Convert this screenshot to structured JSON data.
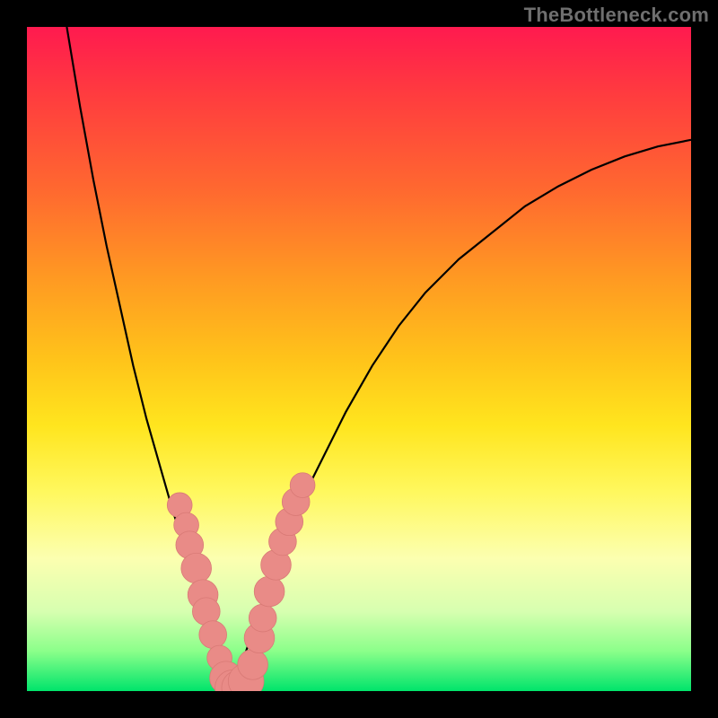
{
  "watermark": "TheBottleneck.com",
  "colors": {
    "dot": "#e98b87",
    "curve": "#000000"
  },
  "chart_data": {
    "type": "line",
    "title": "",
    "xlabel": "",
    "ylabel": "",
    "xlim": [
      0,
      100
    ],
    "ylim": [
      0,
      100
    ],
    "grid": false,
    "series": [
      {
        "name": "left_branch",
        "x": [
          6,
          8,
          10,
          12,
          14,
          16,
          18,
          20,
          22,
          23,
          24,
          25,
          26,
          27,
          28,
          29,
          30,
          31
        ],
        "y": [
          100,
          88,
          77,
          67,
          58,
          49,
          41,
          34,
          27,
          24,
          20,
          17,
          14,
          10,
          7,
          4,
          2,
          0
        ]
      },
      {
        "name": "right_branch",
        "x": [
          31,
          33,
          35,
          37,
          40,
          44,
          48,
          52,
          56,
          60,
          65,
          70,
          75,
          80,
          85,
          90,
          95,
          100
        ],
        "y": [
          0,
          6,
          12,
          18,
          26,
          34,
          42,
          49,
          55,
          60,
          65,
          69,
          73,
          76,
          78.5,
          80.5,
          82,
          83
        ]
      }
    ],
    "markers": [
      {
        "x": 23.0,
        "y": 28.0,
        "r": 1.2
      },
      {
        "x": 24.0,
        "y": 25.0,
        "r": 1.2
      },
      {
        "x": 24.5,
        "y": 22.0,
        "r": 1.4
      },
      {
        "x": 25.5,
        "y": 18.5,
        "r": 1.6
      },
      {
        "x": 26.5,
        "y": 14.5,
        "r": 1.6
      },
      {
        "x": 27.0,
        "y": 12.0,
        "r": 1.4
      },
      {
        "x": 28.0,
        "y": 8.5,
        "r": 1.4
      },
      {
        "x": 29.0,
        "y": 5.0,
        "r": 1.2
      },
      {
        "x": 30.0,
        "y": 2.0,
        "r": 1.8
      },
      {
        "x": 31.0,
        "y": 0.5,
        "r": 2.0
      },
      {
        "x": 32.0,
        "y": 0.5,
        "r": 2.0
      },
      {
        "x": 33.0,
        "y": 1.5,
        "r": 2.0
      },
      {
        "x": 34.0,
        "y": 4.0,
        "r": 1.6
      },
      {
        "x": 35.0,
        "y": 8.0,
        "r": 1.6
      },
      {
        "x": 35.5,
        "y": 11.0,
        "r": 1.4
      },
      {
        "x": 36.5,
        "y": 15.0,
        "r": 1.6
      },
      {
        "x": 37.5,
        "y": 19.0,
        "r": 1.6
      },
      {
        "x": 38.5,
        "y": 22.5,
        "r": 1.4
      },
      {
        "x": 39.5,
        "y": 25.5,
        "r": 1.4
      },
      {
        "x": 40.5,
        "y": 28.5,
        "r": 1.4
      },
      {
        "x": 41.5,
        "y": 31.0,
        "r": 1.2
      }
    ]
  }
}
